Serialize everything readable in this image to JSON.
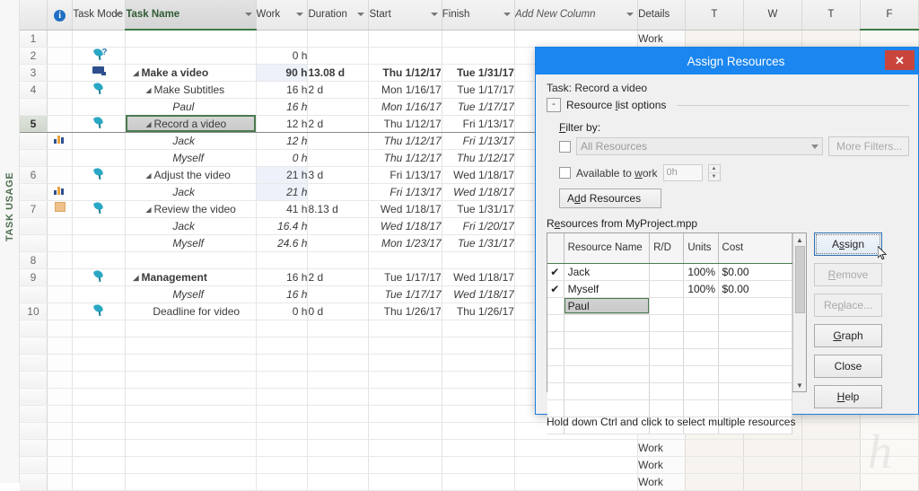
{
  "view": {
    "vertical_label": "TASK USAGE"
  },
  "grid": {
    "headers": {
      "row_number": "",
      "indicator_icon": "info-icon",
      "task_mode": "Task Mode",
      "task_name": "Task Name",
      "work": "Work",
      "duration": "Duration",
      "start": "Start",
      "finish": "Finish",
      "add_new_column": "Add New Column",
      "details": "Details",
      "days": [
        "T",
        "W",
        "T",
        "F"
      ]
    },
    "rows": [
      {
        "num": "1",
        "icon": "",
        "mode": "",
        "name": "",
        "indent": 0,
        "work": "",
        "dur": "",
        "start": "",
        "finish": "",
        "detail": ""
      },
      {
        "num": "2",
        "icon": "",
        "mode": "pin-question",
        "name": "",
        "indent": 0,
        "work": "0 h",
        "dur": "",
        "start": "",
        "finish": "",
        "detail": ""
      },
      {
        "num": "3",
        "icon": "",
        "mode": "monitor",
        "name": "Make a video",
        "indent": 1,
        "style": "bold",
        "collapse": true,
        "work": "90 h",
        "dur": "13.08 d",
        "start": "Thu 1/12/17",
        "finish": "Tue 1/31/17",
        "work_hl": true,
        "detail": ""
      },
      {
        "num": "4",
        "icon": "",
        "mode": "pin",
        "name": "Make Subtitles",
        "indent": 2,
        "collapse": true,
        "work": "16 h",
        "dur": "2 d",
        "start": "Mon 1/16/17",
        "finish": "Tue 1/17/17",
        "detail": ""
      },
      {
        "num": "",
        "icon": "",
        "mode": "",
        "name": "Paul",
        "indent": 3,
        "style": "italic",
        "work": "16 h",
        "dur": "",
        "start": "Mon 1/16/17",
        "finish": "Tue 1/17/17",
        "detail": ""
      },
      {
        "num": "5",
        "icon": "",
        "mode": "pin",
        "name": "Record a video",
        "indent": 2,
        "collapse": true,
        "selected": true,
        "work": "12 h",
        "dur": "2 d",
        "start": "Thu 1/12/17",
        "finish": "Fri 1/13/17",
        "detail": ""
      },
      {
        "num": "",
        "icon": "chart",
        "mode": "",
        "name": "Jack",
        "indent": 3,
        "style": "italic",
        "work": "12 h",
        "dur": "",
        "start": "Thu 1/12/17",
        "finish": "Fri 1/13/17",
        "detail": ""
      },
      {
        "num": "",
        "icon": "",
        "mode": "",
        "name": "Myself",
        "indent": 3,
        "style": "italic",
        "work": "0 h",
        "dur": "",
        "start": "Thu 1/12/17",
        "finish": "Thu 1/12/17",
        "detail": ""
      },
      {
        "num": "6",
        "icon": "",
        "mode": "pin",
        "name": "Adjust the video",
        "indent": 2,
        "collapse": true,
        "work": "21 h",
        "dur": "3 d",
        "start": "Fri 1/13/17",
        "finish": "Wed 1/18/17",
        "work_hl": true,
        "detail": ""
      },
      {
        "num": "",
        "icon": "chart",
        "mode": "",
        "name": "Jack",
        "indent": 3,
        "style": "italic",
        "work": "21 h",
        "dur": "",
        "start": "Fri 1/13/17",
        "finish": "Wed 1/18/17",
        "work_hl": true,
        "detail": ""
      },
      {
        "num": "7",
        "icon": "note",
        "mode": "pin",
        "name": "Review the video",
        "indent": 2,
        "collapse": true,
        "work": "41 h",
        "dur": "8.13 d",
        "start": "Wed 1/18/17",
        "finish": "Tue 1/31/17",
        "detail": ""
      },
      {
        "num": "",
        "icon": "",
        "mode": "",
        "name": "Jack",
        "indent": 3,
        "style": "italic",
        "work": "16.4 h",
        "dur": "",
        "start": "Wed 1/18/17",
        "finish": "Fri 1/20/17",
        "detail": ""
      },
      {
        "num": "",
        "icon": "",
        "mode": "",
        "name": "Myself",
        "indent": 3,
        "style": "italic",
        "work": "24.6 h",
        "dur": "",
        "start": "Mon 1/23/17",
        "finish": "Tue 1/31/17",
        "detail": ""
      },
      {
        "num": "8",
        "icon": "",
        "mode": "",
        "name": "",
        "indent": 0,
        "work": "",
        "dur": "",
        "start": "",
        "finish": "",
        "detail": ""
      },
      {
        "num": "9",
        "icon": "",
        "mode": "pin",
        "name": "Management",
        "indent": 1,
        "collapse": true,
        "work": "16 h",
        "dur": "2 d",
        "start": "Tue 1/17/17",
        "finish": "Wed 1/18/17",
        "detail": ""
      },
      {
        "num": "",
        "icon": "",
        "mode": "",
        "name": "Myself",
        "indent": 3,
        "style": "italic",
        "work": "16 h",
        "dur": "",
        "start": "Tue 1/17/17",
        "finish": "Wed 1/18/17",
        "detail": ""
      },
      {
        "num": "10",
        "icon": "",
        "mode": "pin",
        "name": "Deadline for video",
        "indent": 2,
        "work": "0 h",
        "dur": "0 d",
        "start": "Thu 1/26/17",
        "finish": "Thu 1/26/17",
        "detail": ""
      },
      {
        "num": "",
        "icon": "",
        "mode": "",
        "name": "",
        "indent": 0,
        "work": "",
        "dur": "",
        "start": "",
        "finish": "",
        "detail": ""
      },
      {
        "num": "",
        "icon": "",
        "mode": "",
        "name": "",
        "indent": 0,
        "work": "",
        "dur": "",
        "start": "",
        "finish": "",
        "detail": ""
      },
      {
        "num": "",
        "icon": "",
        "mode": "",
        "name": "",
        "indent": 0,
        "work": "",
        "dur": "",
        "start": "",
        "finish": "",
        "detail": ""
      },
      {
        "num": "",
        "icon": "",
        "mode": "",
        "name": "",
        "indent": 0,
        "work": "",
        "dur": "",
        "start": "",
        "finish": "",
        "detail": ""
      },
      {
        "num": "",
        "icon": "",
        "mode": "",
        "name": "",
        "indent": 0,
        "work": "",
        "dur": "",
        "start": "",
        "finish": "",
        "detail": ""
      },
      {
        "num": "",
        "icon": "",
        "mode": "",
        "name": "",
        "indent": 0,
        "work": "",
        "dur": "",
        "start": "",
        "finish": "",
        "detail": "Work"
      },
      {
        "num": "",
        "icon": "",
        "mode": "",
        "name": "",
        "indent": 0,
        "work": "",
        "dur": "",
        "start": "",
        "finish": "",
        "detail": "Work"
      },
      {
        "num": "",
        "icon": "",
        "mode": "",
        "name": "",
        "indent": 0,
        "work": "",
        "dur": "",
        "start": "",
        "finish": "",
        "detail": "Work"
      },
      {
        "num": "",
        "icon": "",
        "mode": "",
        "name": "",
        "indent": 0,
        "work": "",
        "dur": "",
        "start": "",
        "finish": "",
        "detail": "Work"
      },
      {
        "num": "",
        "icon": "",
        "mode": "",
        "name": "",
        "indent": 0,
        "work": "",
        "dur": "",
        "start": "",
        "finish": "",
        "detail": "Work"
      }
    ],
    "detail_header_row_label": "Work"
  },
  "dialog": {
    "title": "Assign Resources",
    "close_label": "✕",
    "task_line": "Task: Record a video",
    "resource_list_options": {
      "toggle": "-",
      "label": "Resource list options"
    },
    "filter_by_label": "Filter by:",
    "filter_value": "All Resources",
    "more_filters_label": "More Filters...",
    "available_to_work_label": "Available to work",
    "available_value": "0h",
    "add_resources_label": "Add Resources",
    "resources_from_label": "Resources from MyProject.mpp",
    "table": {
      "columns": [
        "",
        "Resource Name",
        "R/D",
        "Units",
        "Cost"
      ],
      "rows": [
        {
          "checked": "✔",
          "name": "Jack",
          "rd": "",
          "units": "100%",
          "cost": "$0.00"
        },
        {
          "checked": "✔",
          "name": "Myself",
          "rd": "",
          "units": "100%",
          "cost": "$0.00"
        },
        {
          "checked": "",
          "name": "Paul",
          "rd": "",
          "units": "",
          "cost": "",
          "selected": true
        },
        {
          "checked": "",
          "name": "",
          "rd": "",
          "units": "",
          "cost": ""
        },
        {
          "checked": "",
          "name": "",
          "rd": "",
          "units": "",
          "cost": ""
        },
        {
          "checked": "",
          "name": "",
          "rd": "",
          "units": "",
          "cost": ""
        },
        {
          "checked": "",
          "name": "",
          "rd": "",
          "units": "",
          "cost": ""
        },
        {
          "checked": "",
          "name": "",
          "rd": "",
          "units": "",
          "cost": ""
        },
        {
          "checked": "",
          "name": "",
          "rd": "",
          "units": "",
          "cost": ""
        },
        {
          "checked": "",
          "name": "",
          "rd": "",
          "units": "",
          "cost": ""
        }
      ]
    },
    "buttons": {
      "assign": "Assign",
      "remove": "Remove",
      "replace": "Replace...",
      "graph": "Graph",
      "close": "Close",
      "help": "Help"
    },
    "hint": "Hold down Ctrl and click to select multiple resources"
  },
  "colors": {
    "dialog_title_bg": "#1b86f0",
    "close_btn_bg": "#c9453c",
    "accent_green": "#3f7a42",
    "selection_gray": "#c8c8c8",
    "work_highlight": "#edf1fa"
  }
}
